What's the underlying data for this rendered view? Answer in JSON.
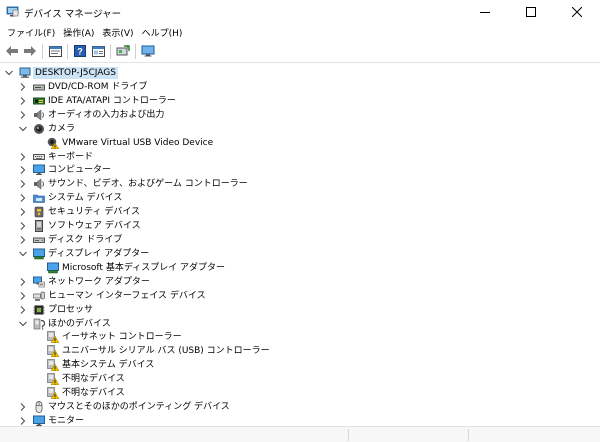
{
  "window": {
    "title": "デバイス マネージャー",
    "icon": "device-manager-icon",
    "controls": [
      "minimize-icon",
      "maximize-icon",
      "close-icon"
    ]
  },
  "menu": [
    {
      "label": "ファイル(F)"
    },
    {
      "label": "操作(A)"
    },
    {
      "label": "表示(V)"
    },
    {
      "label": "ヘルプ(H)"
    }
  ],
  "toolbar": [
    "back-icon",
    "forward-icon",
    "properties-sheet-icon",
    "help-icon",
    "view-icon",
    "update-driver-icon",
    "monitor-icon"
  ],
  "tree": [
    {
      "label": "DESKTOP-J5CJAGS",
      "level": 0,
      "expander": "expanded",
      "icon": "computer-icon",
      "selected": true
    },
    {
      "label": "DVD/CD-ROM ドライブ",
      "level": 1,
      "expander": "collapsed",
      "icon": "dvd-drive-icon"
    },
    {
      "label": "IDE ATA/ATAPI コントローラー",
      "level": 1,
      "expander": "collapsed",
      "icon": "ide-controller-icon"
    },
    {
      "label": "オーディオの入力および出力",
      "level": 1,
      "expander": "collapsed",
      "icon": "speaker-icon"
    },
    {
      "label": "カメラ",
      "level": 1,
      "expander": "expanded",
      "icon": "camera-icon"
    },
    {
      "label": "VMware Virtual USB Video Device",
      "level": 2,
      "expander": "none",
      "icon": "camera-warning-icon"
    },
    {
      "label": "キーボード",
      "level": 1,
      "expander": "collapsed",
      "icon": "keyboard-icon"
    },
    {
      "label": "コンピューター",
      "level": 1,
      "expander": "collapsed",
      "icon": "monitor-icon"
    },
    {
      "label": "サウンド、ビデオ、およびゲーム コントローラー",
      "level": 1,
      "expander": "collapsed",
      "icon": "speaker-icon"
    },
    {
      "label": "システム デバイス",
      "level": 1,
      "expander": "collapsed",
      "icon": "system-folder-icon"
    },
    {
      "label": "セキュリティ デバイス",
      "level": 1,
      "expander": "collapsed",
      "icon": "security-key-icon"
    },
    {
      "label": "ソフトウェア デバイス",
      "level": 1,
      "expander": "collapsed",
      "icon": "software-device-icon"
    },
    {
      "label": "ディスク ドライブ",
      "level": 1,
      "expander": "collapsed",
      "icon": "disk-drive-icon"
    },
    {
      "label": "ディスプレイ アダプター",
      "level": 1,
      "expander": "expanded",
      "icon": "display-adapter-icon"
    },
    {
      "label": "Microsoft 基本ディスプレイ アダプター",
      "level": 2,
      "expander": "none",
      "icon": "display-adapter-icon"
    },
    {
      "label": "ネットワーク アダプター",
      "level": 1,
      "expander": "collapsed",
      "icon": "network-adapter-icon"
    },
    {
      "label": "ヒューマン インターフェイス デバイス",
      "level": 1,
      "expander": "collapsed",
      "icon": "hid-icon"
    },
    {
      "label": "プロセッサ",
      "level": 1,
      "expander": "collapsed",
      "icon": "processor-icon"
    },
    {
      "label": "ほかのデバイス",
      "level": 1,
      "expander": "expanded",
      "icon": "other-devices-icon"
    },
    {
      "label": "イーサネット コントローラー",
      "level": 2,
      "expander": "none",
      "icon": "warning-device-icon"
    },
    {
      "label": "ユニバーサル シリアル バス (USB) コントローラー",
      "level": 2,
      "expander": "none",
      "icon": "warning-device-icon"
    },
    {
      "label": "基本システム デバイス",
      "level": 2,
      "expander": "none",
      "icon": "warning-device-icon"
    },
    {
      "label": "不明なデバイス",
      "level": 2,
      "expander": "none",
      "icon": "warning-device-icon"
    },
    {
      "label": "不明なデバイス",
      "level": 2,
      "expander": "none",
      "icon": "warning-device-icon"
    },
    {
      "label": "マウスとそのほかのポインティング デバイス",
      "level": 1,
      "expander": "collapsed",
      "icon": "mouse-icon"
    },
    {
      "label": "モニター",
      "level": 1,
      "expander": "collapsed",
      "icon": "monitor-icon"
    }
  ],
  "colors": {
    "selection": "#cde4f7",
    "accent": "#1e6fc4",
    "warning": "#f0c400"
  }
}
